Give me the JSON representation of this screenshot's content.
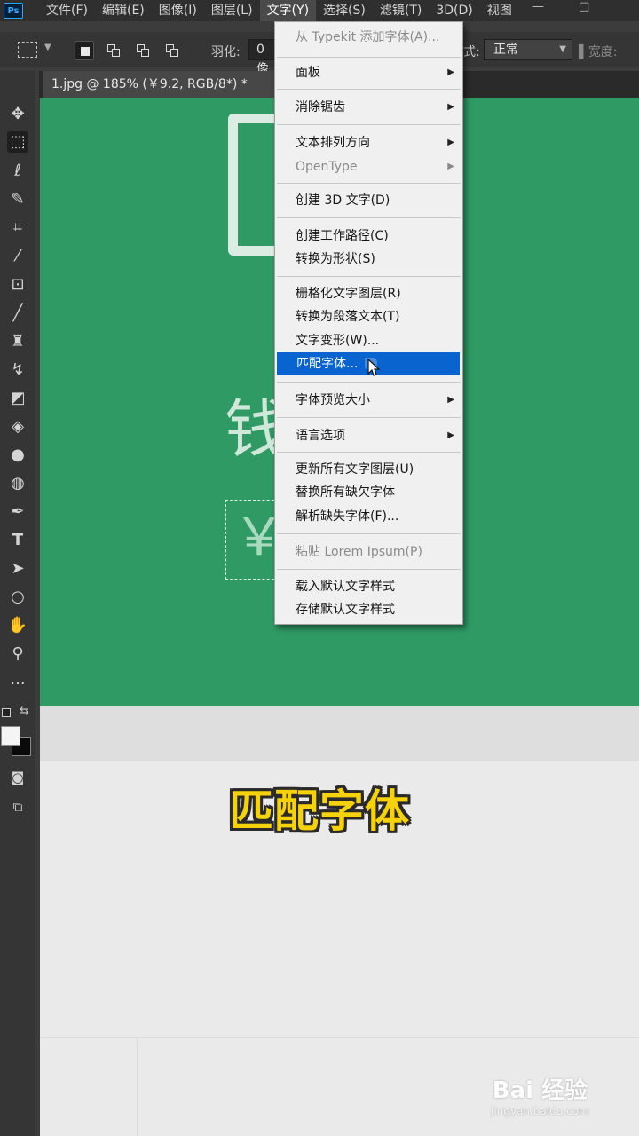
{
  "menubar": {
    "app_logo": "Ps",
    "items": [
      "文件(F)",
      "编辑(E)",
      "图像(I)",
      "图层(L)",
      "文字(Y)",
      "选择(S)",
      "滤镜(T)",
      "3D(D)",
      "视图"
    ],
    "active_index": 4,
    "window_buttons": [
      "—",
      "□"
    ]
  },
  "options": {
    "feather_label": "羽化:",
    "feather_value": "0 像",
    "style_label_partial": "式:",
    "style_value": "正常",
    "width_label": "宽度:"
  },
  "document_tab": {
    "title": "1.jpg @ 185% (￥9.2, RGB/8*) *",
    "close": "×"
  },
  "canvas": {
    "glyph": "钱",
    "yen": "￥",
    "background_color": "#2f9a64"
  },
  "menu": {
    "items": [
      {
        "label": "从 Typekit 添加字体(A)...",
        "disabled": true,
        "submenu": false
      },
      {
        "label": "面板",
        "disabled": false,
        "submenu": true
      },
      {
        "label": "消除锯齿",
        "disabled": false,
        "submenu": true
      },
      {
        "label": "文本排列方向",
        "disabled": false,
        "submenu": true
      },
      {
        "label": "OpenType",
        "disabled": true,
        "submenu": true
      },
      {
        "label": "创建 3D 文字(D)",
        "disabled": false,
        "submenu": false
      },
      {
        "label": "创建工作路径(C)",
        "disabled": false,
        "submenu": false
      },
      {
        "label": "转换为形状(S)",
        "disabled": false,
        "submenu": false
      },
      {
        "label": "栅格化文字图层(R)",
        "disabled": false,
        "submenu": false
      },
      {
        "label": "转换为段落文本(T)",
        "disabled": false,
        "submenu": false
      },
      {
        "label": "文字变形(W)...",
        "disabled": false,
        "submenu": false
      },
      {
        "label": "匹配字体...",
        "disabled": false,
        "submenu": false,
        "highlighted": true
      },
      {
        "label": "字体预览大小",
        "disabled": false,
        "submenu": true
      },
      {
        "label": "语言选项",
        "disabled": false,
        "submenu": true
      },
      {
        "label": "更新所有文字图层(U)",
        "disabled": false,
        "submenu": false
      },
      {
        "label": "替换所有缺欠字体",
        "disabled": false,
        "submenu": false
      },
      {
        "label": "解析缺失字体(F)...",
        "disabled": false,
        "submenu": false
      },
      {
        "label": "粘贴 Lorem Ipsum(P)",
        "disabled": true,
        "submenu": false
      },
      {
        "label": "载入默认文字样式",
        "disabled": false,
        "submenu": false
      },
      {
        "label": "存储默认文字样式",
        "disabled": false,
        "submenu": false
      }
    ],
    "submenu_arrow": "▶"
  },
  "caption": "匹配字体",
  "watermark": {
    "main": "Bai 经验",
    "sub": "jingyan.baidu.com"
  },
  "toolbar": {
    "tools": [
      "move",
      "marquee",
      "lasso",
      "quick-select",
      "crop",
      "eyedropper",
      "healing",
      "brush",
      "stamp",
      "history-brush",
      "eraser",
      "paint-bucket",
      "blur",
      "dodge",
      "pen",
      "type",
      "path-select",
      "ellipse",
      "hand",
      "zoom",
      "more"
    ],
    "active_tool": "marquee",
    "type_tool_glyph": "T",
    "more_glyph": "···"
  }
}
